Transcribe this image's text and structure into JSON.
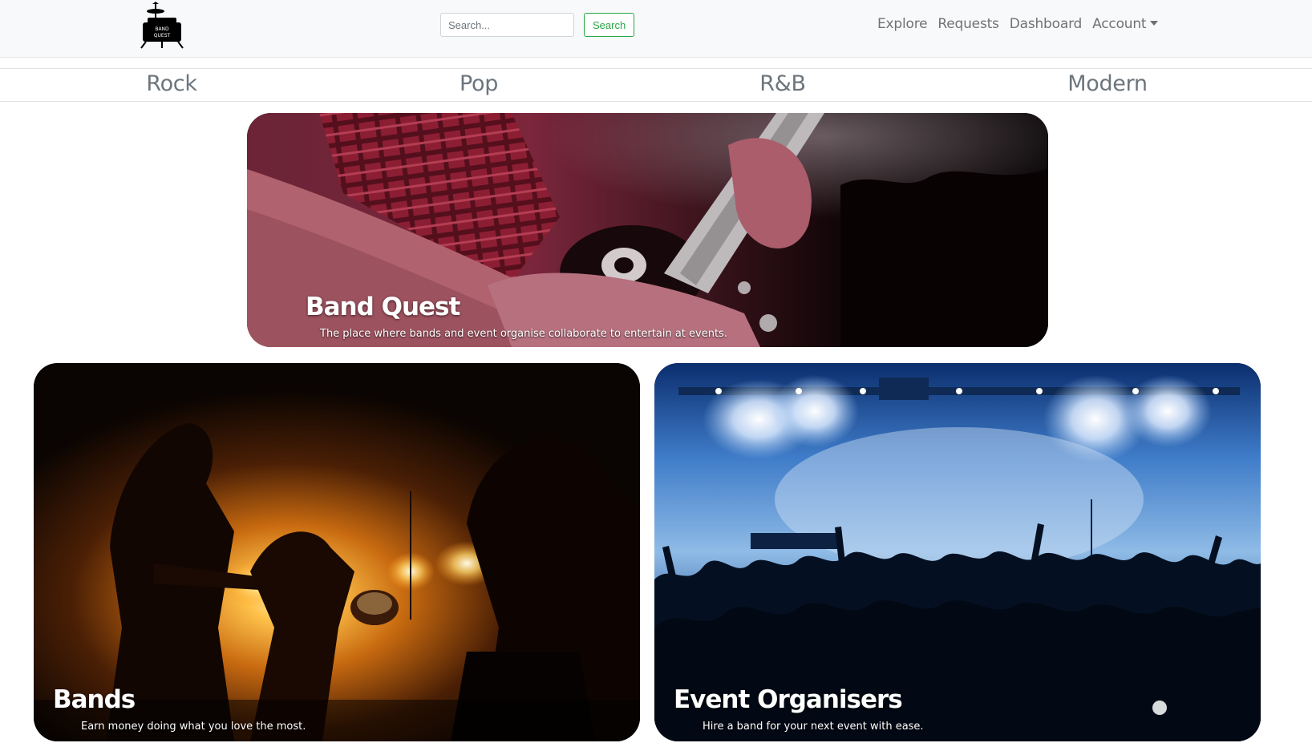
{
  "brand": {
    "logo_text_line1": "BAND",
    "logo_text_line2": "QUEST"
  },
  "search": {
    "placeholder": "Search...",
    "button_label": "Search"
  },
  "nav": {
    "links": [
      {
        "label": "Explore"
      },
      {
        "label": "Requests"
      },
      {
        "label": "Dashboard"
      },
      {
        "label": "Account",
        "dropdown": true
      }
    ]
  },
  "genres": [
    {
      "label": "Rock"
    },
    {
      "label": "Pop"
    },
    {
      "label": "R&B"
    },
    {
      "label": "Modern"
    }
  ],
  "hero": {
    "title": "Band Quest",
    "text": "The place where bands and event organise collaborate to entertain at events.",
    "image": "guitarist-closeup-photo"
  },
  "cards": [
    {
      "title": "Bands",
      "text": "Earn money doing what you love the most.",
      "image": "band-on-stage-photo"
    },
    {
      "title": "Event Organisers",
      "text": "Hire a band for your next event with ease.",
      "image": "concert-crowd-photo"
    }
  ],
  "colors": {
    "navbar_bg": "#f8f9fa",
    "nav_link": "#737373",
    "search_button": "#28a745",
    "genre_link": "#6c757d",
    "card_text": "#ffffff"
  }
}
